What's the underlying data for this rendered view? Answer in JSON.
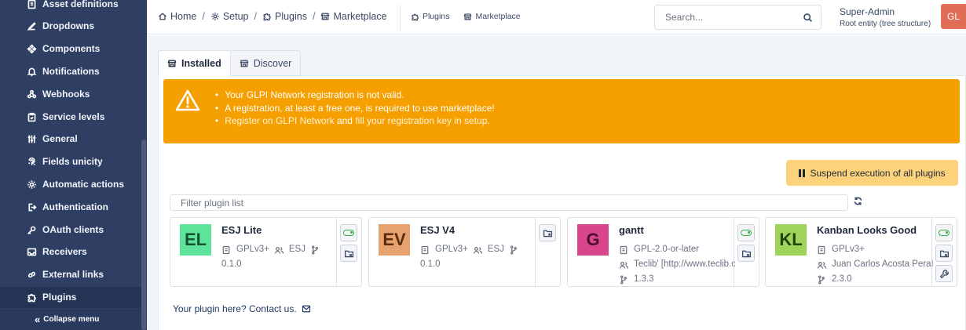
{
  "sidebar": {
    "items": [
      {
        "label": "Asset definitions",
        "icon": "asset-definitions-icon"
      },
      {
        "label": "Dropdowns",
        "icon": "dropdowns-icon"
      },
      {
        "label": "Components",
        "icon": "components-icon"
      },
      {
        "label": "Notifications",
        "icon": "bell-icon"
      },
      {
        "label": "Webhooks",
        "icon": "webhook-icon"
      },
      {
        "label": "Service levels",
        "icon": "service-levels-icon"
      },
      {
        "label": "General",
        "icon": "sliders-icon"
      },
      {
        "label": "Fields unicity",
        "icon": "fingerprint-icon"
      },
      {
        "label": "Automatic actions",
        "icon": "gear-icon"
      },
      {
        "label": "Authentication",
        "icon": "login-icon"
      },
      {
        "label": "OAuth clients",
        "icon": "key-icon"
      },
      {
        "label": "Receivers",
        "icon": "inbox-icon"
      },
      {
        "label": "External links",
        "icon": "link-icon"
      },
      {
        "label": "Plugins",
        "icon": "puzzle-icon"
      }
    ],
    "collapse_label": "Collapse menu"
  },
  "topbar": {
    "breadcrumb": [
      "Home",
      "Setup",
      "Plugins",
      "Marketplace"
    ],
    "quick_links": [
      "Plugins",
      "Marketplace"
    ],
    "search_placeholder": "Search...",
    "user_name": "Super-Admin",
    "user_entity": "Root entity (tree structure)",
    "avatar_initials": "GL"
  },
  "tabs": [
    "Installed",
    "Discover"
  ],
  "alert": {
    "line1": "Your GLPI Network registration is not valid.",
    "line2": "A registration, at least a free one, is required to use marketplace!",
    "line3_link1": "Register on GLPI Network",
    "line3_and": "and",
    "line3_link2": "fill your registration key in setup."
  },
  "suspend_label": "Suspend execution of all plugins",
  "filter_placeholder": "Filter plugin list",
  "plugins": [
    {
      "initials": "EL",
      "name": "ESJ Lite",
      "license": "GPLv3+",
      "authors": "ESJ",
      "version": "0.1.0",
      "logo_bg": "#5ee39b",
      "logo_fg": "#14532d"
    },
    {
      "initials": "EV",
      "name": "ESJ V4",
      "license": "GPLv3+",
      "authors": "ESJ",
      "version": "0.1.0",
      "logo_bg": "#e6a26f",
      "logo_fg": "#5b2d0c"
    },
    {
      "initials": "G",
      "name": "gantt",
      "license": "GPL-2.0-or-later",
      "authors": "Teclib' [http://www.teclib.com]",
      "version": "1.3.3",
      "logo_bg": "#d9468e",
      "logo_fg": "#4a0f2a"
    },
    {
      "initials": "KL",
      "name": "Kanban Looks Good",
      "license": "GPLv3+",
      "authors": "Juan Carlos Acosta Perabá",
      "version": "2.3.0",
      "logo_bg": "#9ed45a",
      "logo_fg": "#23410b"
    }
  ],
  "contact_text": "Your plugin here? Contact us."
}
